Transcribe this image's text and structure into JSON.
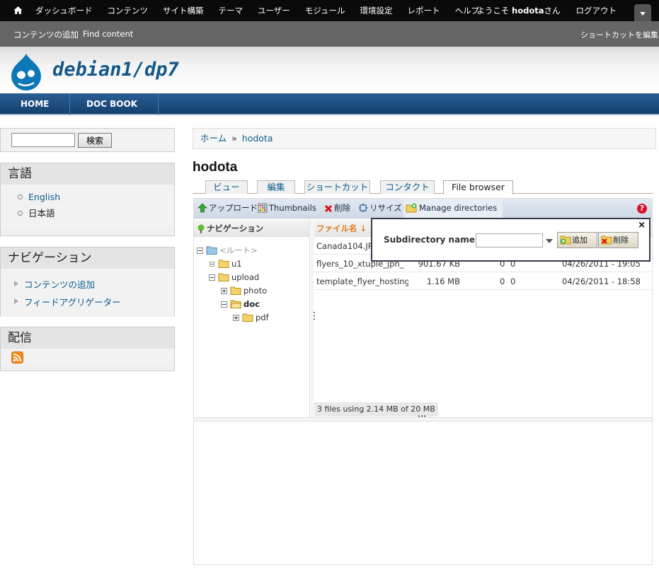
{
  "toolbar": {
    "menu": [
      "ダッシュボード",
      "コンテンツ",
      "サイト構築",
      "テーマ",
      "ユーザー",
      "モジュール",
      "環境設定",
      "レポート",
      "ヘルプ"
    ],
    "welcome_prefix": "ようこそ ",
    "username": "hodota",
    "welcome_suffix": "さん",
    "logout": "ログアウト"
  },
  "shortcuts": {
    "items": [
      "コンテンツの追加",
      "Find content"
    ],
    "edit": "ショートカットを編集"
  },
  "header": {
    "site_name": "debian1/dp7"
  },
  "mainnav": [
    "HOME",
    "DOC BOOK"
  ],
  "sidebar": {
    "search_button": "検索",
    "language": {
      "title": "言語",
      "items": [
        "English",
        "日本語"
      ]
    },
    "navigation": {
      "title": "ナビゲーション",
      "items": [
        "コンテンツの追加",
        "フィードアグリゲーター"
      ]
    },
    "syndication": {
      "title": "配信"
    }
  },
  "breadcrumb": {
    "home": "ホーム",
    "sep": "»",
    "current": "hodota"
  },
  "page_title": "hodota",
  "tabs": [
    "ビュー",
    "編集",
    "ショートカット",
    "コンタクト",
    "File browser"
  ],
  "filebrowser": {
    "ops": {
      "upload": "アップロード",
      "thumbnails": "Thumbnails",
      "delete": "削除",
      "resize": "リサイズ",
      "manage": "Manage directories"
    },
    "help": "?",
    "nav_title": "ナビゲーション",
    "tree": [
      "<ルート>",
      "u1",
      "upload",
      "photo",
      "doc",
      "pdf"
    ],
    "file_header": "ファイル名 ↓",
    "files": [
      {
        "name": "Canada104.JPG",
        "size": "",
        "w": "",
        "h": "",
        "date": ""
      },
      {
        "name": "flyers_10_xtuple_jpn_",
        "size": "901.67 KB",
        "w": "0",
        "h": "0",
        "date": "04/26/2011 - 19:05"
      },
      {
        "name": "template_flyer_hosting",
        "size": "1.16 MB",
        "w": "0",
        "h": "0",
        "date": "04/26/2011 - 18:58"
      }
    ],
    "status": "3 files using 2.14 MB of 20 MB"
  },
  "popup": {
    "close": "×",
    "label": "Subdirectory name",
    "add": "追加",
    "remove": "削除"
  }
}
